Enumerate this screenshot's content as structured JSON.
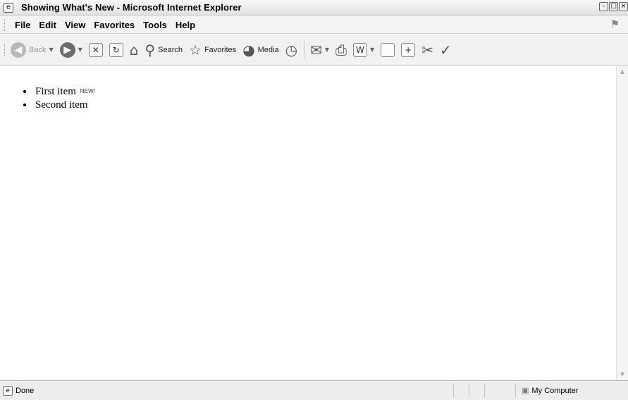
{
  "window": {
    "title": "Showing What's New - Microsoft Internet Explorer",
    "app_icon": "ie-icon"
  },
  "menu": [
    "File",
    "Edit",
    "View",
    "Favorites",
    "Tools",
    "Help"
  ],
  "toolbar": {
    "back_label": "Back",
    "search_label": "Search",
    "favorites_label": "Favorites",
    "media_label": "Media"
  },
  "content": {
    "items": [
      {
        "text": "First item",
        "badge": "NEW!"
      },
      {
        "text": "Second item",
        "badge": ""
      }
    ]
  },
  "status": {
    "text": "Done",
    "zone": "My Computer"
  }
}
